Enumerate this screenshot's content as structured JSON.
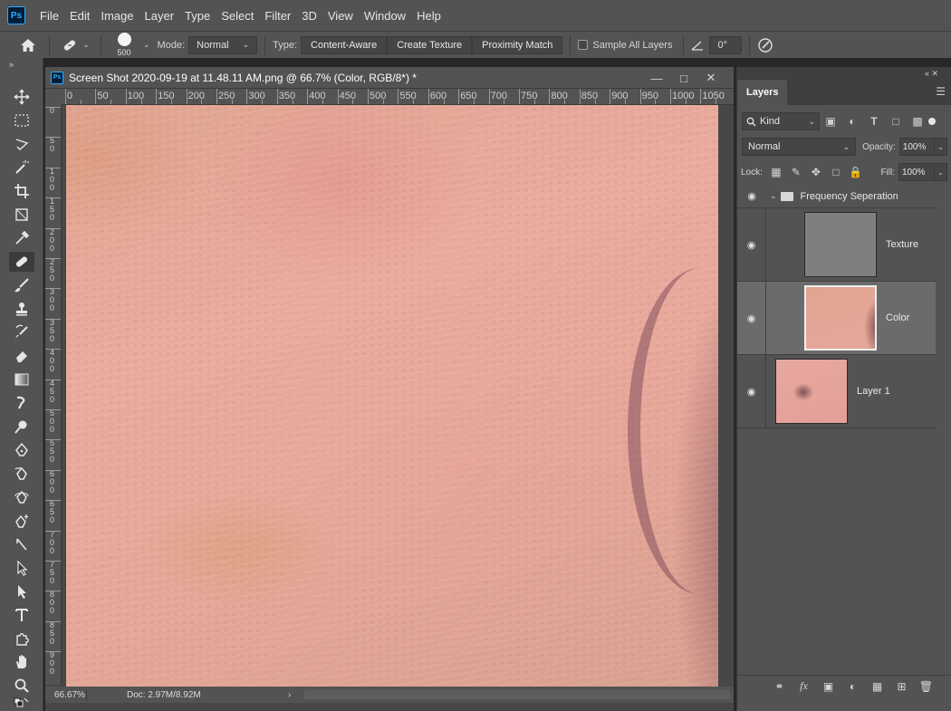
{
  "menubar": {
    "logo": "Ps",
    "items": [
      "File",
      "Edit",
      "Image",
      "Layer",
      "Type",
      "Select",
      "Filter",
      "3D",
      "View",
      "Window",
      "Help"
    ]
  },
  "options": {
    "brush_size": "500",
    "mode_label": "Mode:",
    "mode_value": "Normal",
    "type_label": "Type:",
    "type_buttons": [
      "Content-Aware",
      "Create Texture",
      "Proximity Match"
    ],
    "sample_all_layers": "Sample All Layers",
    "angle_value": "0°"
  },
  "document": {
    "title": "Screen Shot 2020-09-19 at 11.48.11 AM.png @ 66.7% (Color, RGB/8*) *",
    "ruler_top": [
      "0",
      "50",
      "100",
      "150",
      "200",
      "250",
      "300",
      "350",
      "400",
      "450",
      "500",
      "550",
      "600",
      "650",
      "700",
      "750",
      "800",
      "850",
      "900",
      "950",
      "1000",
      "1050"
    ],
    "ruler_left": [
      "0",
      "50",
      "100",
      "150",
      "200",
      "250",
      "300",
      "350",
      "400",
      "450",
      "500",
      "550",
      "600",
      "650",
      "700",
      "750",
      "800",
      "850",
      "900"
    ],
    "zoom": "66.67%",
    "doc_info": "Doc: 2.97M/8.92M"
  },
  "layers_panel": {
    "tab": "Layers",
    "kind": "Kind",
    "blend_mode": "Normal",
    "opacity_label": "Opacity:",
    "opacity": "100%",
    "lock_label": "Lock:",
    "fill_label": "Fill:",
    "fill": "100%",
    "group_name": "Frequency Seperation",
    "layers": [
      "Texture",
      "Color",
      "Layer 1"
    ]
  },
  "colors": {
    "chrome": "#535353",
    "dark": "#282828",
    "selected_layer": "#6b6b6b",
    "skin": "#e6a79a"
  }
}
